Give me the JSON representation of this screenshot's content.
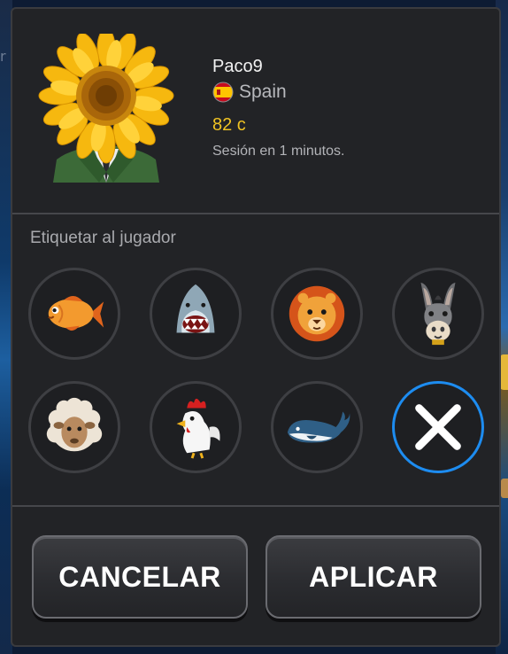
{
  "player": {
    "name": "Paco9",
    "country": "Spain",
    "coins": "82 c",
    "session": "Sesión en 1 minutos."
  },
  "tags": {
    "title": "Etiquetar al jugador",
    "items": [
      {
        "icon": "fish-icon"
      },
      {
        "icon": "shark-icon"
      },
      {
        "icon": "lion-icon"
      },
      {
        "icon": "donkey-icon"
      },
      {
        "icon": "sheep-icon"
      },
      {
        "icon": "rooster-icon"
      },
      {
        "icon": "whale-icon"
      },
      {
        "icon": "close-icon",
        "selected": true
      }
    ]
  },
  "buttons": {
    "cancel": "CANCELAR",
    "apply": "APLICAR"
  },
  "colors": {
    "coins": "#f0c323",
    "selected_ring": "#1d8cf0",
    "modal_bg": "#222326"
  }
}
